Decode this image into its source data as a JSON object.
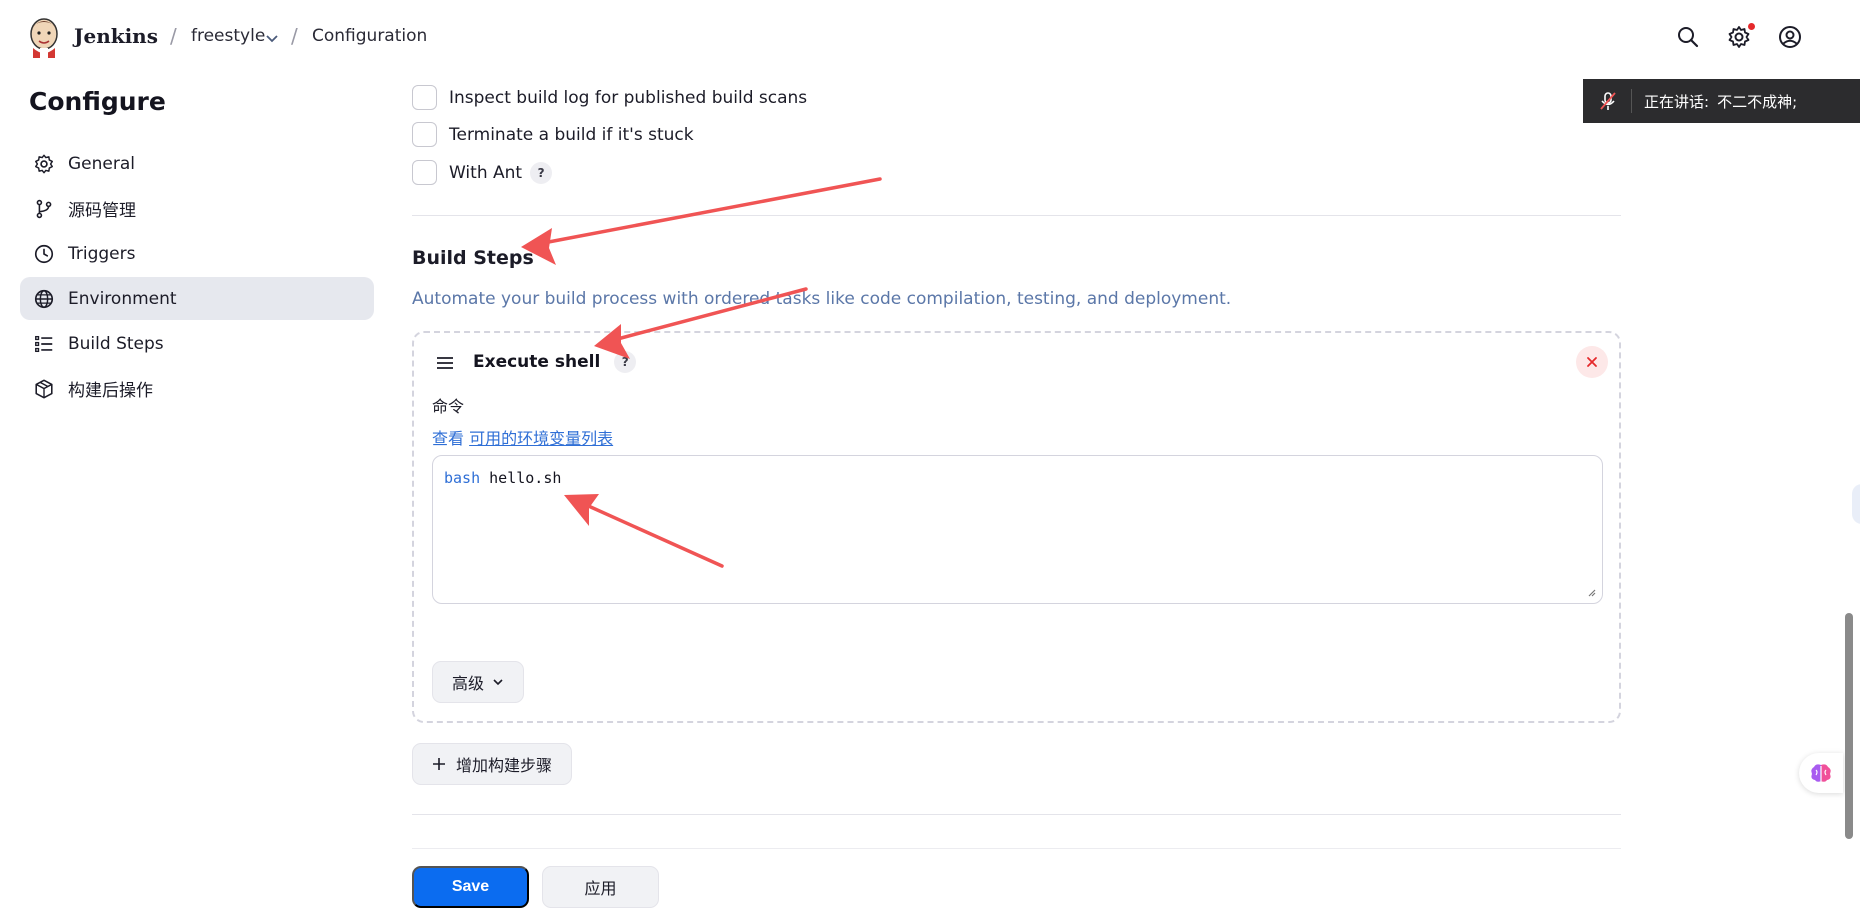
{
  "header": {
    "brand": "Jenkins",
    "breadcrumb": [
      "freestyle",
      "Configuration"
    ],
    "icons": [
      "search-icon",
      "gear-icon",
      "user-icon"
    ]
  },
  "sidebar": {
    "title": "Configure",
    "items": [
      {
        "label": "General",
        "icon": "gear-icon"
      },
      {
        "label": "源码管理",
        "icon": "branch-icon"
      },
      {
        "label": "Triggers",
        "icon": "clock-icon"
      },
      {
        "label": "Environment",
        "icon": "globe-icon",
        "active": true
      },
      {
        "label": "Build Steps",
        "icon": "list-icon"
      },
      {
        "label": "构建后操作",
        "icon": "box-icon"
      }
    ]
  },
  "environment_options": [
    {
      "label": "Inspect build log for published build scans",
      "checked": false
    },
    {
      "label": "Terminate a build if it's stuck",
      "checked": false
    },
    {
      "label": "With Ant",
      "checked": false,
      "help": "?"
    }
  ],
  "build_steps": {
    "title": "Build Steps",
    "description": "Automate your build process with ordered tasks like code compilation, testing, and deployment.",
    "step": {
      "title": "Execute shell",
      "help": "?",
      "command_label": "命令",
      "see_prefix": "查看",
      "env_link": "可用的环境变量列表",
      "command_keyword": "bash",
      "command_rest": " hello.sh",
      "advanced_label": "高级"
    },
    "add_step_label": "增加构建步骤"
  },
  "footer": {
    "save_label": "Save",
    "apply_label": "应用"
  },
  "overlay": {
    "speaking_label": "正在讲话:",
    "speaker_name": "不二不成神;"
  },
  "colors": {
    "primary": "#0b6cf0",
    "link": "#2f6fd6",
    "description": "#5b77a8",
    "annotation": "#f05454"
  }
}
